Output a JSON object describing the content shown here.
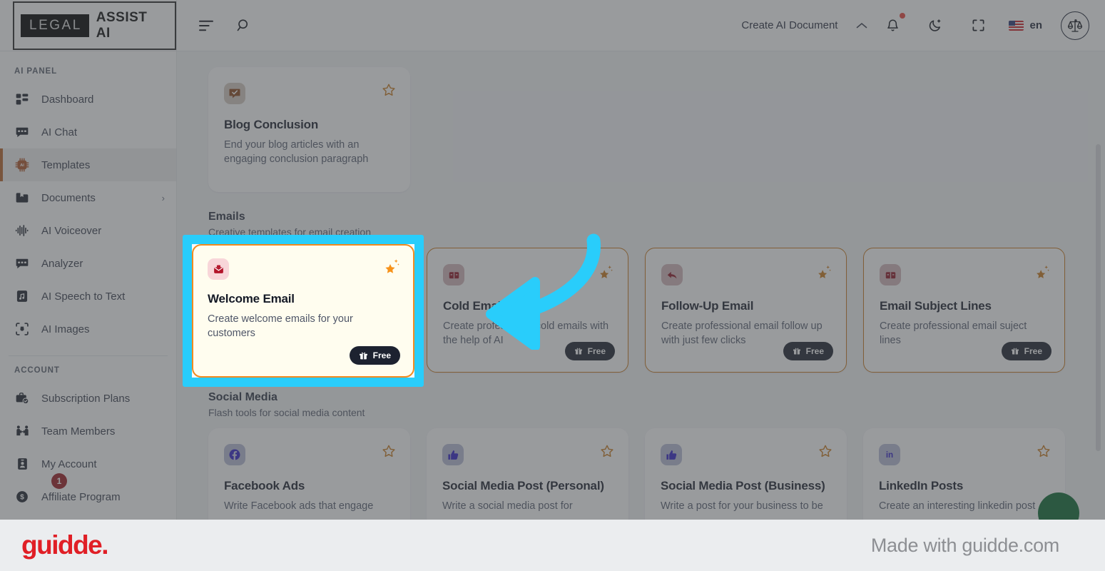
{
  "brand": {
    "logo_dark": "LEGAL",
    "logo_light": "ASSIST AI"
  },
  "topbar": {
    "menu_icon": "menu-icon",
    "search_icon": "search-icon",
    "create_document": "Create AI Document",
    "chevron_icon": "chevron-up-icon",
    "notification_icon": "bell-icon",
    "theme_icon": "moon-icon",
    "fullscreen_icon": "fullscreen-icon",
    "language": "en",
    "flag": "us-flag-icon",
    "avatar_icon": "scales-of-justice-icon"
  },
  "sidebar": {
    "sections": [
      {
        "label": "AI PANEL",
        "items": [
          {
            "label": "Dashboard",
            "icon": "dashboard-icon",
            "active": false
          },
          {
            "label": "AI Chat",
            "icon": "chat-icon",
            "active": false
          },
          {
            "label": "Templates",
            "icon": "chip-ai-icon",
            "active": true
          },
          {
            "label": "Documents",
            "icon": "folder-icon",
            "active": false,
            "chevron": "›"
          },
          {
            "label": "AI Voiceover",
            "icon": "waveform-icon",
            "active": false
          },
          {
            "label": "Analyzer",
            "icon": "chat-icon",
            "active": false
          },
          {
            "label": "AI Speech to Text",
            "icon": "audio-file-icon",
            "active": false
          },
          {
            "label": "AI Images",
            "icon": "camera-icon",
            "active": false
          }
        ]
      },
      {
        "label": "ACCOUNT",
        "items": [
          {
            "label": "Subscription Plans",
            "icon": "briefcase-check-icon",
            "active": false
          },
          {
            "label": "Team Members",
            "icon": "team-icon",
            "active": false
          },
          {
            "label": "My Account",
            "icon": "id-card-icon",
            "active": false
          },
          {
            "label": "Affiliate Program",
            "icon": "coin-icon",
            "active": false,
            "badge": "1"
          }
        ]
      }
    ]
  },
  "content": {
    "top_card": {
      "title": "Blog Conclusion",
      "desc": "End your blog articles with an engaging conclusion paragraph",
      "icon": "comment-check-icon",
      "star": "star-outline-icon"
    },
    "sections": [
      {
        "title": "Emails",
        "subtitle": "Creative templates for email creation",
        "cards": [
          {
            "title": "Welcome Email",
            "desc": "Create welcome emails for your customers",
            "icon": "mailbox-icon",
            "star": "star-filled-icon",
            "pill": "Free",
            "pill_icon": "gift-icon",
            "highlighted": true
          },
          {
            "title": "Cold Email",
            "desc": "Create professional cold emails with the help of AI",
            "icon": "mailbox-open-icon",
            "star": "star-filled-icon",
            "pill": "Free",
            "pill_icon": "gift-icon",
            "highlighted": false
          },
          {
            "title": "Follow-Up Email",
            "desc": "Create professional email follow up with just few clicks",
            "icon": "reply-icon",
            "star": "star-filled-icon",
            "pill": "Free",
            "pill_icon": "gift-icon",
            "highlighted": false
          },
          {
            "title": "Email Subject Lines",
            "desc": "Create professional email suject lines",
            "icon": "mailbox-open-icon",
            "star": "star-filled-icon",
            "pill": "Free",
            "pill_icon": "gift-icon",
            "highlighted": false
          }
        ]
      },
      {
        "title": "Social Media",
        "subtitle": "Flash tools for social media content",
        "cards": [
          {
            "title": "Facebook Ads",
            "desc": "Write Facebook ads that engage",
            "icon": "facebook-icon",
            "star": "star-outline-icon"
          },
          {
            "title": "Social Media Post (Personal)",
            "desc": "Write a social media post for",
            "icon": "thumbs-up-icon",
            "star": "star-outline-icon"
          },
          {
            "title": "Social Media Post (Business)",
            "desc": "Write a post for your business to be",
            "icon": "thumbs-up-icon",
            "star": "star-outline-icon"
          },
          {
            "title": "LinkedIn Posts",
            "desc": "Create an interesting linkedin post",
            "icon": "linkedin-icon",
            "star": "star-outline-icon"
          }
        ]
      }
    ]
  },
  "footer": {
    "logo": "guidde.",
    "made_with": "Made with guidde.com"
  },
  "colors": {
    "highlight": "#29cdfb",
    "card_highlight_bg": "#fffdef",
    "card_highlight_border": "#f18b20",
    "accent_orange": "#c97a1e",
    "sidebar_active_bar": "#b8652a",
    "guidde_red": "#e01f26",
    "fab_green": "#0f6b33"
  }
}
